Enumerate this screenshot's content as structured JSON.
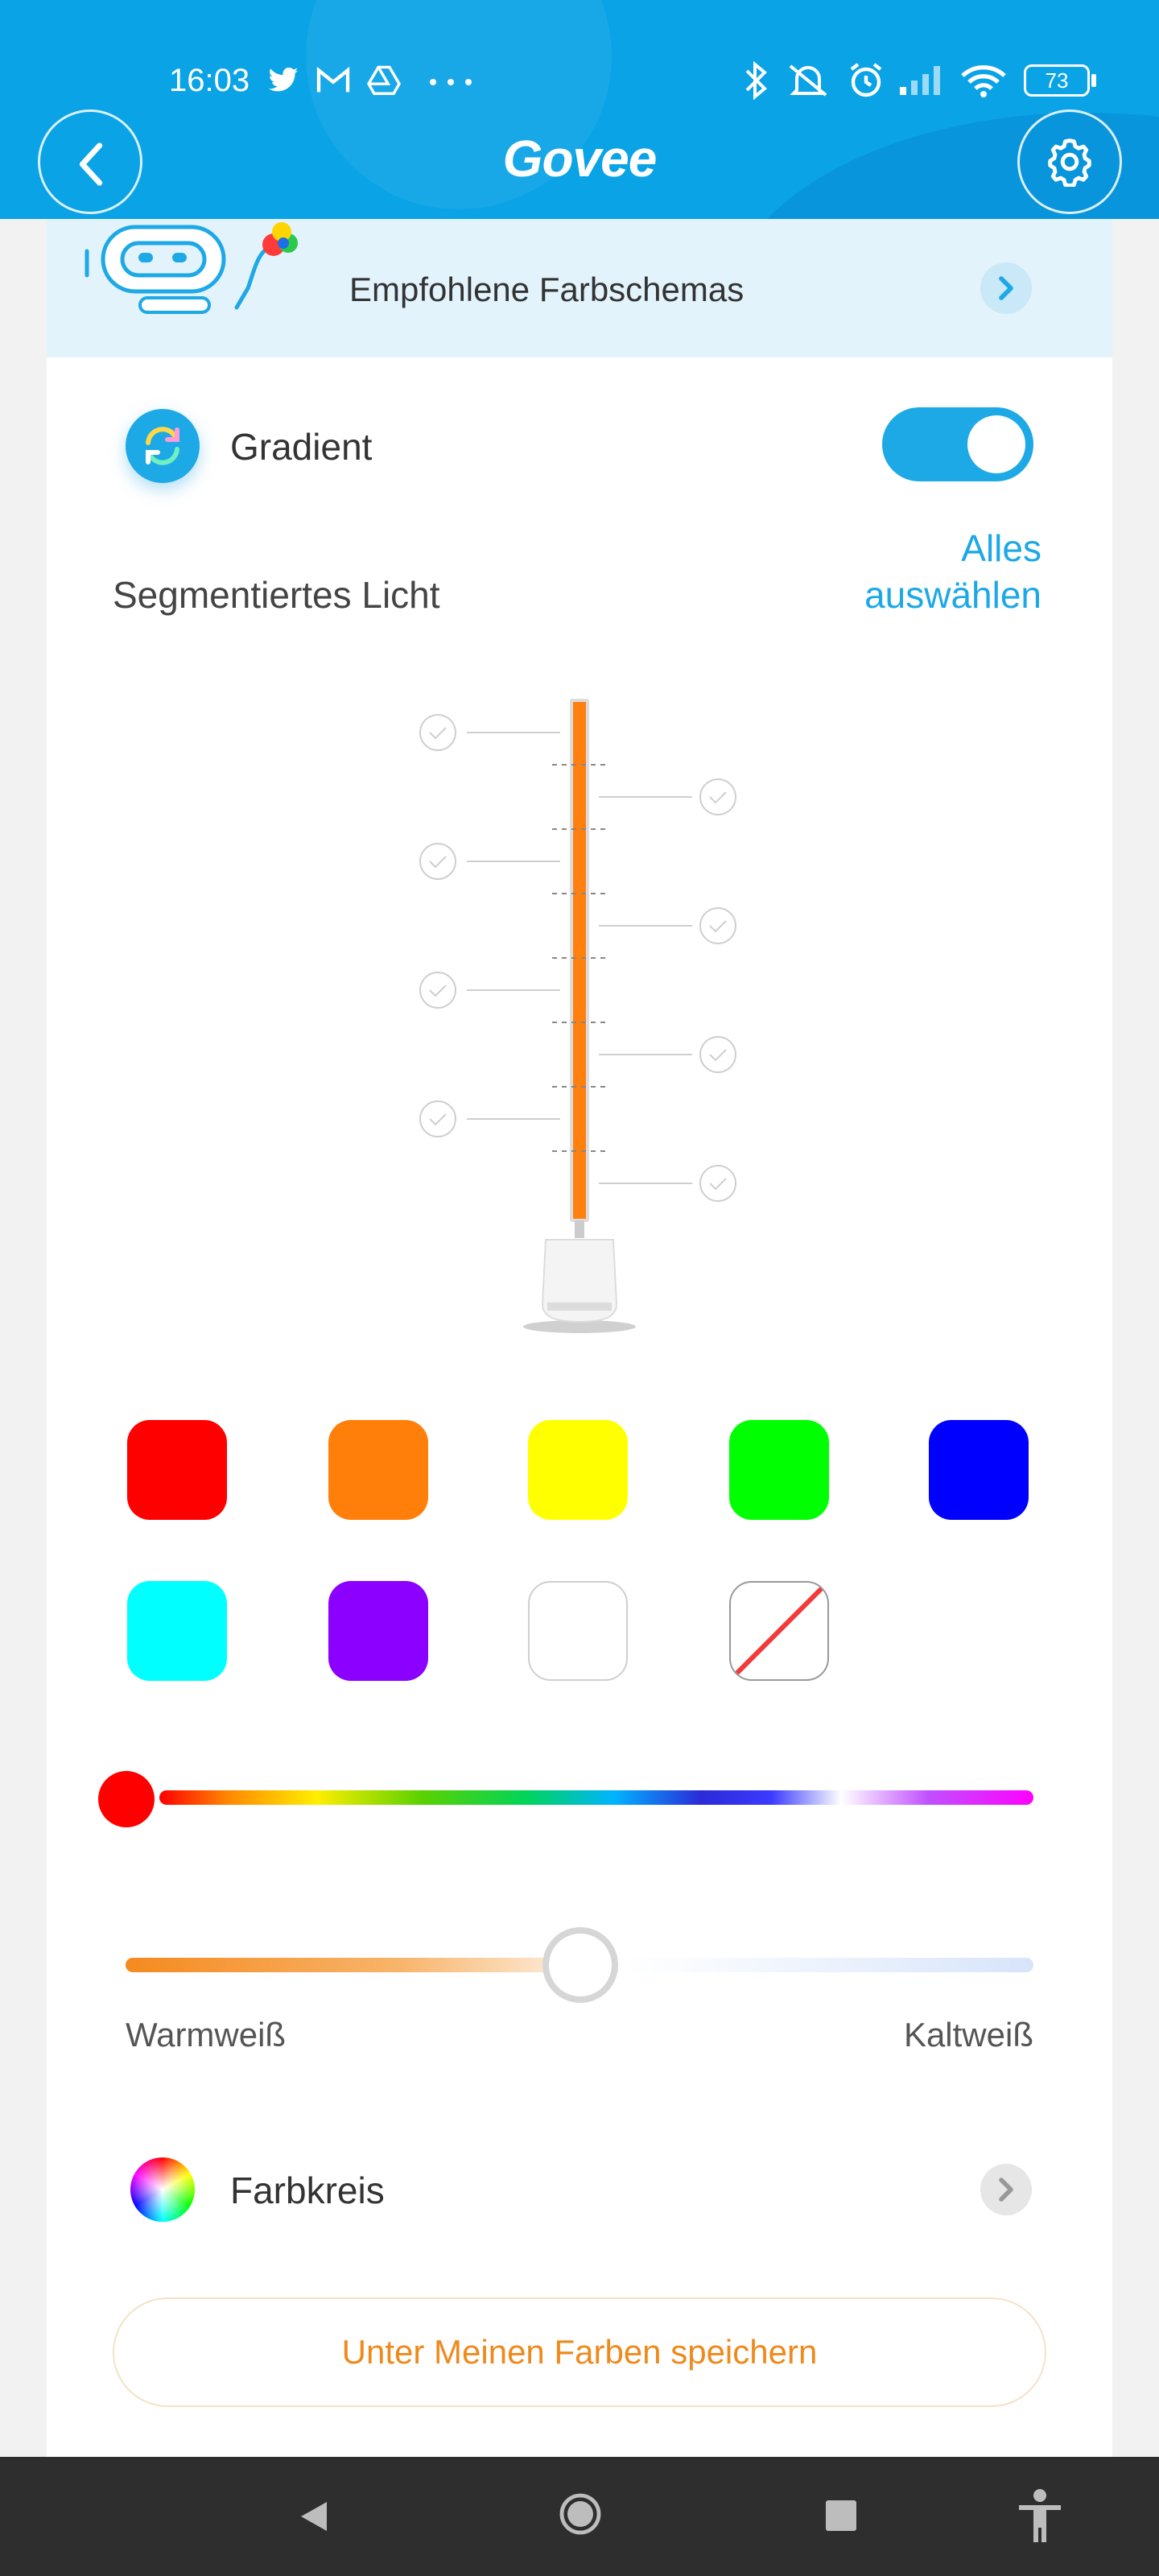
{
  "status_bar": {
    "time": "16:03",
    "battery": "73",
    "icons": [
      "twitter-icon",
      "gmail-icon",
      "drive-icon",
      "more-dots-icon",
      "bluetooth-icon",
      "mute-icon",
      "alarm-icon",
      "signal-icon",
      "wifi-icon",
      "battery-icon"
    ]
  },
  "header": {
    "logo": "Govee",
    "back_icon": "chevron-left-icon",
    "settings_icon": "gear-icon"
  },
  "banner": {
    "label": "Empfohlene Farbschemas",
    "chevron_icon": "chevron-right-icon"
  },
  "gradient": {
    "label": "Gradient",
    "enabled": true
  },
  "segments": {
    "label": "Segmentiertes Licht",
    "select_all_line1": "Alles",
    "select_all_line2": "auswählen",
    "count": 8,
    "color": "#ff7f0f"
  },
  "swatches": [
    "#ff0000",
    "#ff7f0a",
    "#ffff00",
    "#00ff00",
    "#0000ff",
    "#00ffff",
    "#8b00ff",
    "#ffffff",
    "none"
  ],
  "color_slider": {
    "selected": "#ff0000"
  },
  "white_slider": {
    "warm_label": "Warmweiß",
    "cold_label": "Kaltweiß",
    "level": 0.5
  },
  "color_wheel": {
    "label": "Farbkreis",
    "chevron_icon": "chevron-right-icon"
  },
  "save_button": "Unter Meinen Farben speichern",
  "colors": {
    "accent": "#1da8e6",
    "header": "#0aa3e6",
    "save_text": "#ee8a1c"
  },
  "navbar": {
    "icons": [
      "back-triangle-icon",
      "home-circle-icon",
      "recents-square-icon",
      "accessibility-icon"
    ]
  }
}
